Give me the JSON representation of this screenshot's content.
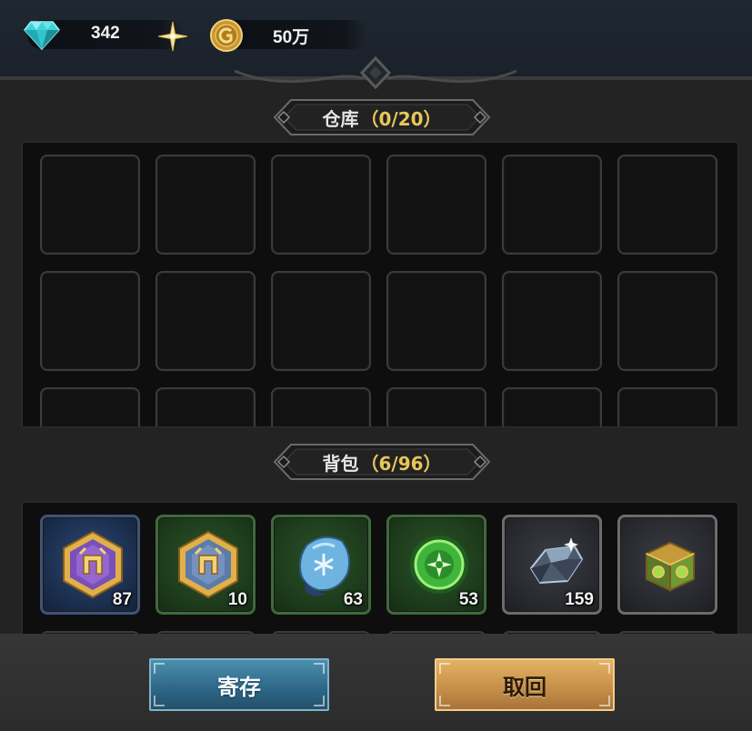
{
  "currency": {
    "gems": "342",
    "gold": "50万"
  },
  "storage": {
    "title": "仓库",
    "count": "（0/20）",
    "rows_visible": 3,
    "cols": 6
  },
  "bag": {
    "title": "背包",
    "count": "（6/96）",
    "items": [
      {
        "name": "purple-helmet-emblem",
        "quality": "blue",
        "qty": "87",
        "icon": "purple-hex-emblem-icon"
      },
      {
        "name": "blue-helmet-emblem",
        "quality": "green",
        "qty": "10",
        "icon": "blue-hex-emblem-icon"
      },
      {
        "name": "ice-rune-stone",
        "quality": "green",
        "qty": "63",
        "icon": "rune-stone-icon"
      },
      {
        "name": "green-energy-orb",
        "quality": "green",
        "qty": "53",
        "icon": "green-orb-icon"
      },
      {
        "name": "dark-crystal",
        "quality": "gray",
        "qty": "159",
        "icon": "crystal-icon"
      },
      {
        "name": "green-treasure-chest",
        "quality": "gray",
        "qty": "",
        "icon": "chest-icon"
      }
    ]
  },
  "actions": {
    "deposit": "寄存",
    "withdraw": "取回"
  },
  "colors": {
    "accent_gold": "#e8c65a",
    "deposit_button": "#2f6a8a",
    "withdraw_button": "#c8914a"
  }
}
